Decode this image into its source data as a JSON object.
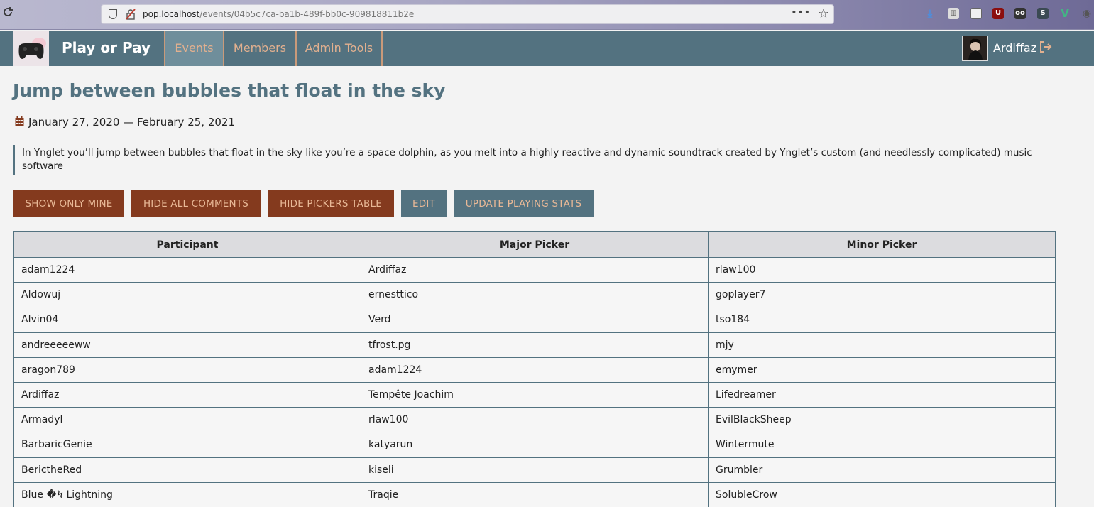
{
  "browser": {
    "url_host": "pop.localhost",
    "url_path": "/events/04b5c7ca-ba1b-489f-bb0c-909818811b2e",
    "more_glyph": "•••"
  },
  "header": {
    "brand": "Play or Pay",
    "nav": [
      {
        "label": "Events",
        "active": true
      },
      {
        "label": "Members",
        "active": false
      },
      {
        "label": "Admin Tools",
        "active": false
      }
    ],
    "user_name": "Ardiffaz"
  },
  "event": {
    "title": "Jump between bubbles that float in the sky",
    "date_range": "January 27, 2020 — February 25, 2021",
    "description": "In Ynglet you’ll jump between bubbles that float in the sky like you’re a space dolphin, as you melt into a highly reactive and dynamic soundtrack created by Ynglet’s custom (and needlessly complicated) music software"
  },
  "buttons": {
    "show_only_mine": "SHOW ONLY MINE",
    "hide_all_comments": "HIDE ALL COMMENTS",
    "hide_pickers_table": "HIDE PICKERS TABLE",
    "edit": "EDIT",
    "update_playing_stats": "UPDATE PLAYING STATS"
  },
  "table": {
    "headers": [
      "Participant",
      "Major Picker",
      "Minor Picker"
    ],
    "rows": [
      [
        "adam1224",
        "Ardiffaz",
        "rlaw100"
      ],
      [
        "Aldowuj",
        "ernesttico",
        "goplayer7"
      ],
      [
        "Alvin04",
        "Verd",
        "tso184"
      ],
      [
        "andreeeeeww",
        "tfrost.pg",
        "mjy"
      ],
      [
        "aragon789",
        "adam1224",
        "emymer"
      ],
      [
        "Ardiffaz",
        "Tempête Joachim",
        "Lifedreamer"
      ],
      [
        "Armadyl",
        "rlaw100",
        "EvilBlackSheep"
      ],
      [
        "BarbaricGenie",
        "katyarun",
        "Wintermute"
      ],
      [
        "BerictheRed",
        "kiseli",
        "Grumbler"
      ],
      [
        "Blue �Ϟ Lightning",
        "Traqie",
        "SolubleCrow"
      ]
    ]
  },
  "colors": {
    "header_bg": "#537280",
    "accent_rust": "#843a1e",
    "nav_text": "#e2b08f"
  }
}
